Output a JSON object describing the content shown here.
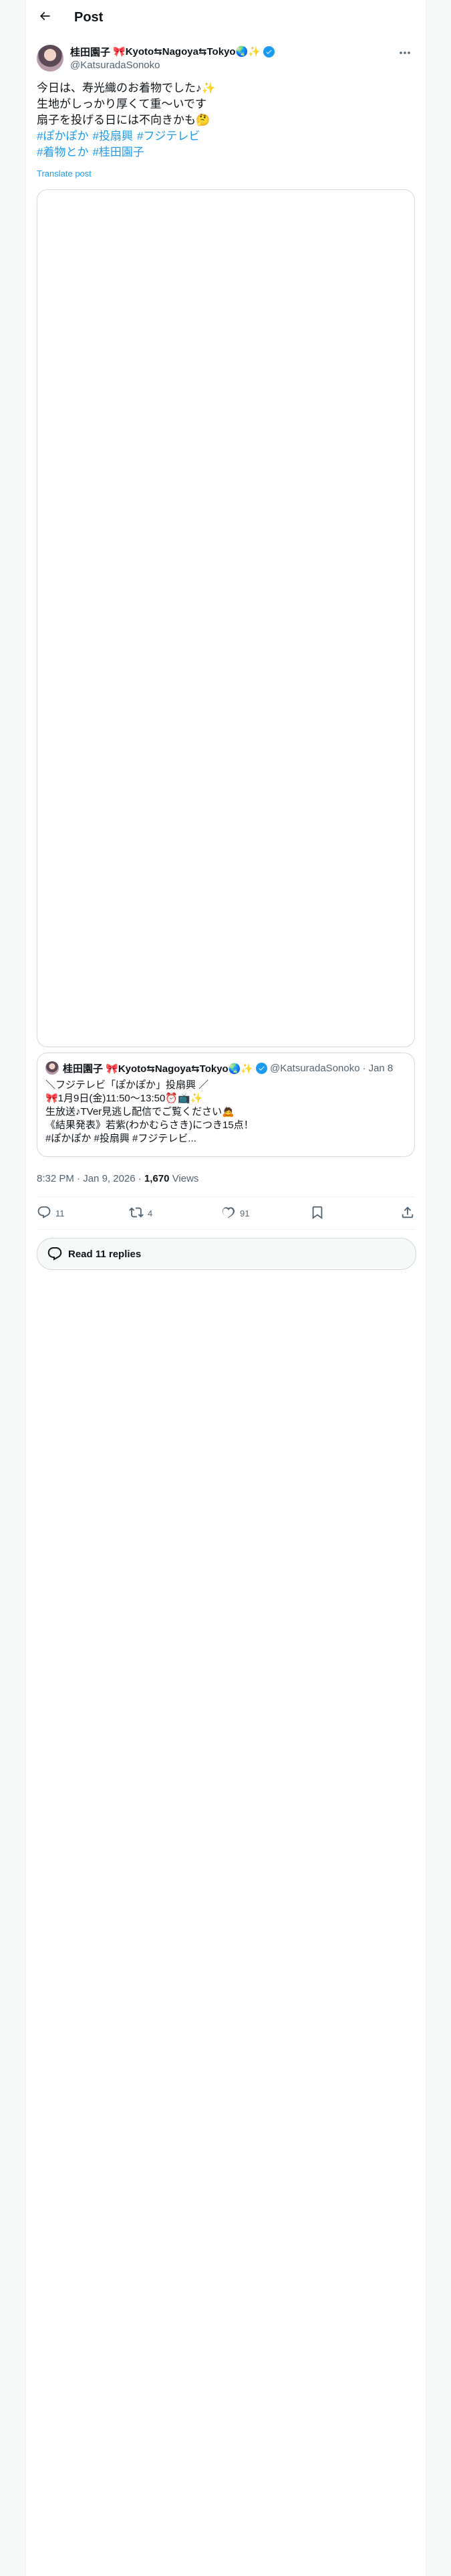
{
  "header": {
    "title": "Post"
  },
  "author": {
    "name": "桂田園子",
    "name_suffix": "🎀Kyoto⇆Nagoya⇆Tokyo🌏✨",
    "handle": "@KatsuradaSonoko"
  },
  "tweet": {
    "lines": [
      "今日は、寿光織のお着物でした♪✨",
      "生地がしっかり厚くて重〜いです",
      "扇子を投げる日には不向きかも🤔"
    ],
    "hashtags_line1": [
      "#ぽかぽか",
      "#投扇興",
      "#フジテレビ"
    ],
    "hashtags_line2": [
      "#着物とか",
      "#桂田園子"
    ],
    "translate_label": "Translate post"
  },
  "quote": {
    "name": "桂田園子 🎀Kyoto⇆Nagoya⇆Tokyo🌏✨",
    "handle": "@KatsuradaSonoko",
    "date": "Jan 8",
    "lines": [
      "＼フジテレビ「ぽかぽか」投扇興 ／",
      "🎀1月9日(金)11:50〜13:50⏰📺✨",
      "生放送♪TVer見逃し配信でご覧ください🙇",
      "《結果発表》若紫(わかむらさき)につき15点！",
      "#ぽかぽか #投扇興 #フジテレビ..."
    ]
  },
  "meta": {
    "time": "8:32 PM",
    "date": "Jan 9, 2026",
    "separator": "·",
    "views_count": "1,670",
    "views_label": "Views"
  },
  "actions": {
    "replies": "11",
    "reposts": "4",
    "likes": "91"
  },
  "read_replies": {
    "label": "Read 11 replies"
  },
  "colors": {
    "link": "#1d9bf0",
    "secondary_text": "#536471",
    "primary_text": "#0f1419",
    "border": "#cfd9de"
  }
}
